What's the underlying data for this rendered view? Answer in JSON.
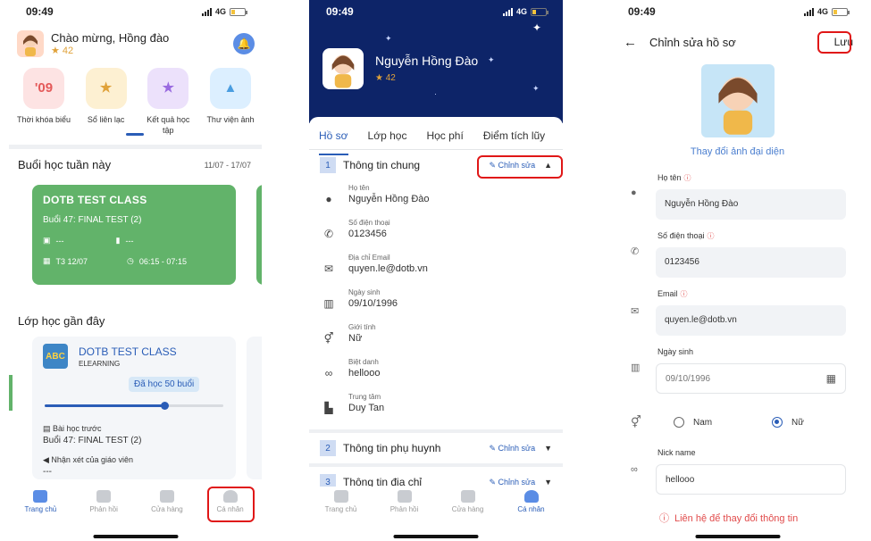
{
  "status": {
    "time": "09:49",
    "network": "4G"
  },
  "home": {
    "greeting": "Chào mừng, Hồng đào",
    "score": "42",
    "features": [
      {
        "label": "Thời khóa biểu",
        "icon_text": "'09",
        "icon": "calendar-icon",
        "bg": "#fde3e3",
        "fg": "#e45a5a"
      },
      {
        "label": "Sổ liên lạc",
        "icon_text": "★",
        "icon": "notebook-icon",
        "bg": "#fdf0d2",
        "fg": "#e0a23a"
      },
      {
        "label": "Kết quả học tập",
        "icon_text": "★",
        "icon": "result-icon",
        "bg": "#ece1fb",
        "fg": "#9a6be0"
      },
      {
        "label": "Thư viện ảnh",
        "icon_text": "▲",
        "icon": "gallery-icon",
        "bg": "#dcefff",
        "fg": "#4a9de0"
      }
    ],
    "week_title": "Buổi học tuần này",
    "week_range": "11/07 - 17/07",
    "week_card": {
      "name": "DOTB TEST CLASS",
      "lesson": "Buổi 47: FINAL TEST (2)",
      "room": "---",
      "teacher": "---",
      "date": "T3 12/07",
      "time": "06:15 - 07:15"
    },
    "recent_title": "Lớp học gần đây",
    "recent_card": {
      "name": "DOTB TEST CLASS",
      "type": "ELEARNING",
      "badge": "Đã học 50 buổi",
      "progress": 0.67,
      "prev_label": "Bài học trước",
      "prev_value": "Buổi 47: FINAL TEST (2)",
      "review_label": "Nhận xét của giáo viên",
      "review_value": "---"
    }
  },
  "tabs": [
    "Trang chủ",
    "Phản hồi",
    "Cửa hàng",
    "Cá nhân"
  ],
  "profile": {
    "name": "Nguyễn Hồng Đào",
    "score": "42",
    "tabs": [
      "Hồ sơ",
      "Lớp học",
      "Học phí",
      "Điểm tích lũy"
    ],
    "sections": [
      {
        "num": "1",
        "title": "Thông tin chung",
        "edit": "Chỉnh sửa"
      },
      {
        "num": "2",
        "title": "Thông tin phụ huynh",
        "edit": "Chỉnh sửa"
      },
      {
        "num": "3",
        "title": "Thông tin địa chỉ",
        "edit": "Chỉnh sửa"
      }
    ],
    "info": [
      {
        "label": "Họ tên",
        "value": "Nguyễn Hồng Đào",
        "icon": "person-icon"
      },
      {
        "label": "Số điện thoại",
        "value": "0123456",
        "icon": "phone-icon"
      },
      {
        "label": "Địa chỉ Email",
        "value": "quyen.le@dotb.vn",
        "icon": "mail-icon"
      },
      {
        "label": "Ngày sinh",
        "value": "09/10/1996",
        "icon": "cake-icon"
      },
      {
        "label": "Giới tính",
        "value": "Nữ",
        "icon": "gender-icon"
      },
      {
        "label": "Biệt danh",
        "value": "hellooo",
        "icon": "glasses-icon"
      },
      {
        "label": "Trung tâm",
        "value": "Duy Tan",
        "icon": "building-icon"
      }
    ]
  },
  "edit": {
    "title": "Chỉnh sửa hồ sơ",
    "save": "Lưu",
    "change_avatar": "Thay đổi ảnh đại diện",
    "fields": [
      {
        "label": "Họ tên",
        "value": "Nguyễn Hồng Đào",
        "required": "ⓘ"
      },
      {
        "label": "Số điện thoại",
        "value": "0123456",
        "required": "ⓘ"
      },
      {
        "label": "Email",
        "value": "quyen.le@dotb.vn",
        "required": "ⓘ"
      },
      {
        "label": "Ngày sinh",
        "value": "09/10/1996"
      }
    ],
    "gender_options": [
      "Nam",
      "Nữ"
    ],
    "nick_label": "Nick name",
    "nick_value": "hellooo",
    "contact": "Liên hệ để thay đổi thông tin"
  }
}
